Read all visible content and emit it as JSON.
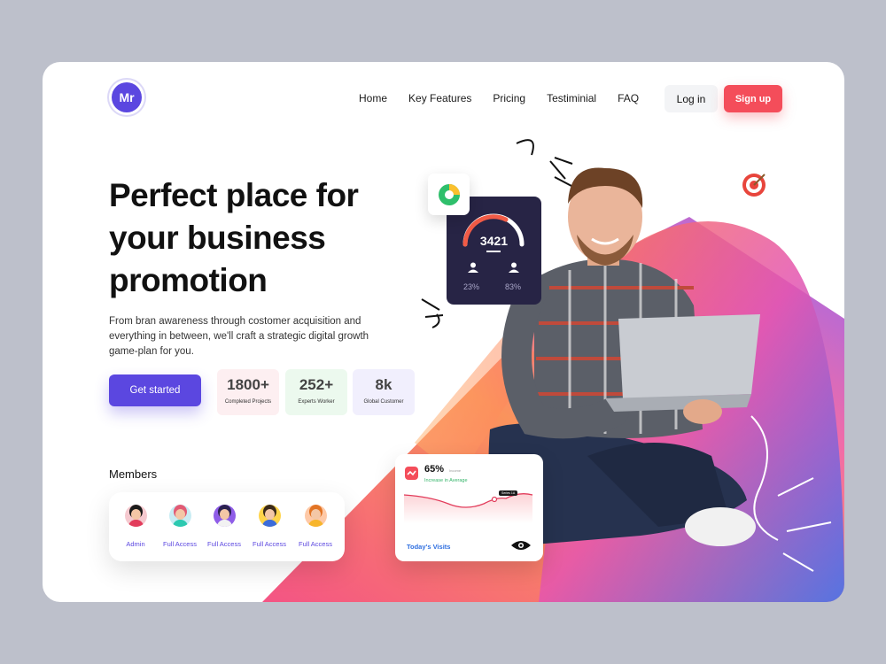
{
  "brand": {
    "logo_text": "Mr"
  },
  "nav": {
    "items": [
      "Home",
      "Key Features",
      "Pricing",
      "Testiminial",
      "FAQ"
    ],
    "login": "Log in",
    "signup": "Sign up"
  },
  "hero": {
    "title_lines": [
      "Perfect place for",
      "your business",
      "promotion"
    ],
    "description": "From bran awareness through costomer acquisition and everything in between, we'll craft a strategic digital growth game-plan for you.",
    "cta": "Get started"
  },
  "stats": [
    {
      "value": "1800+",
      "label": "Completed Projects",
      "bg": "#fdeff1"
    },
    {
      "value": "252+",
      "label": "Experts Worker",
      "bg": "#ecf9ee"
    },
    {
      "value": "8k",
      "label": "Global Customer",
      "bg": "#f1effd"
    }
  ],
  "members": {
    "title": "Members",
    "list": [
      {
        "role": "Admin",
        "avatar_bg": "#f5c9cf",
        "shirt": "#e23c5b",
        "hair": "#1b1b1b"
      },
      {
        "role": "Full Access",
        "avatar_bg": "#c9ecf3",
        "shirt": "#2cc9b0",
        "hair": "#e25a74"
      },
      {
        "role": "Full Access",
        "avatar_bg": "#8f5de8",
        "shirt": "#f2f2f2",
        "hair": "#2a2150"
      },
      {
        "role": "Full Access",
        "avatar_bg": "#ffd44a",
        "shirt": "#3b6cdb",
        "hair": "#3a2a1a"
      },
      {
        "role": "Full Access",
        "avatar_bg": "#fec9a7",
        "shirt": "#f7b52b",
        "hair": "#e27424"
      }
    ]
  },
  "dashboard_card": {
    "value": "3421",
    "user_percent_1": "23%",
    "user_percent_2": "83%",
    "gauge_fraction": 0.62
  },
  "visits_card": {
    "percent": "65%",
    "income_label": "Income",
    "average_label": "Increase in Average",
    "tooltip": "Series 1A",
    "footer_label": "Today's Visits"
  },
  "colors": {
    "primary": "#5b47e0",
    "accent_red": "#f44d5a",
    "dark_card": "#272445"
  }
}
